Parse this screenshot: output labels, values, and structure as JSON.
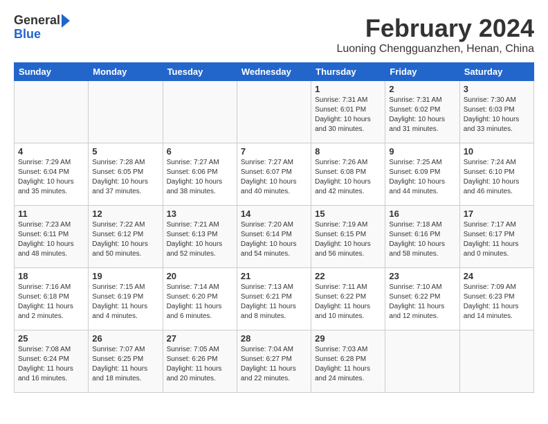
{
  "logo": {
    "line1": "General",
    "line2": "Blue"
  },
  "title": "February 2024",
  "location": "Luoning Chengguanzhen, Henan, China",
  "weekdays": [
    "Sunday",
    "Monday",
    "Tuesday",
    "Wednesday",
    "Thursday",
    "Friday",
    "Saturday"
  ],
  "weeks": [
    [
      {
        "day": "",
        "info": ""
      },
      {
        "day": "",
        "info": ""
      },
      {
        "day": "",
        "info": ""
      },
      {
        "day": "",
        "info": ""
      },
      {
        "day": "1",
        "info": "Sunrise: 7:31 AM\nSunset: 6:01 PM\nDaylight: 10 hours and 30 minutes."
      },
      {
        "day": "2",
        "info": "Sunrise: 7:31 AM\nSunset: 6:02 PM\nDaylight: 10 hours and 31 minutes."
      },
      {
        "day": "3",
        "info": "Sunrise: 7:30 AM\nSunset: 6:03 PM\nDaylight: 10 hours and 33 minutes."
      }
    ],
    [
      {
        "day": "4",
        "info": "Sunrise: 7:29 AM\nSunset: 6:04 PM\nDaylight: 10 hours and 35 minutes."
      },
      {
        "day": "5",
        "info": "Sunrise: 7:28 AM\nSunset: 6:05 PM\nDaylight: 10 hours and 37 minutes."
      },
      {
        "day": "6",
        "info": "Sunrise: 7:27 AM\nSunset: 6:06 PM\nDaylight: 10 hours and 38 minutes."
      },
      {
        "day": "7",
        "info": "Sunrise: 7:27 AM\nSunset: 6:07 PM\nDaylight: 10 hours and 40 minutes."
      },
      {
        "day": "8",
        "info": "Sunrise: 7:26 AM\nSunset: 6:08 PM\nDaylight: 10 hours and 42 minutes."
      },
      {
        "day": "9",
        "info": "Sunrise: 7:25 AM\nSunset: 6:09 PM\nDaylight: 10 hours and 44 minutes."
      },
      {
        "day": "10",
        "info": "Sunrise: 7:24 AM\nSunset: 6:10 PM\nDaylight: 10 hours and 46 minutes."
      }
    ],
    [
      {
        "day": "11",
        "info": "Sunrise: 7:23 AM\nSunset: 6:11 PM\nDaylight: 10 hours and 48 minutes."
      },
      {
        "day": "12",
        "info": "Sunrise: 7:22 AM\nSunset: 6:12 PM\nDaylight: 10 hours and 50 minutes."
      },
      {
        "day": "13",
        "info": "Sunrise: 7:21 AM\nSunset: 6:13 PM\nDaylight: 10 hours and 52 minutes."
      },
      {
        "day": "14",
        "info": "Sunrise: 7:20 AM\nSunset: 6:14 PM\nDaylight: 10 hours and 54 minutes."
      },
      {
        "day": "15",
        "info": "Sunrise: 7:19 AM\nSunset: 6:15 PM\nDaylight: 10 hours and 56 minutes."
      },
      {
        "day": "16",
        "info": "Sunrise: 7:18 AM\nSunset: 6:16 PM\nDaylight: 10 hours and 58 minutes."
      },
      {
        "day": "17",
        "info": "Sunrise: 7:17 AM\nSunset: 6:17 PM\nDaylight: 11 hours and 0 minutes."
      }
    ],
    [
      {
        "day": "18",
        "info": "Sunrise: 7:16 AM\nSunset: 6:18 PM\nDaylight: 11 hours and 2 minutes."
      },
      {
        "day": "19",
        "info": "Sunrise: 7:15 AM\nSunset: 6:19 PM\nDaylight: 11 hours and 4 minutes."
      },
      {
        "day": "20",
        "info": "Sunrise: 7:14 AM\nSunset: 6:20 PM\nDaylight: 11 hours and 6 minutes."
      },
      {
        "day": "21",
        "info": "Sunrise: 7:13 AM\nSunset: 6:21 PM\nDaylight: 11 hours and 8 minutes."
      },
      {
        "day": "22",
        "info": "Sunrise: 7:11 AM\nSunset: 6:22 PM\nDaylight: 11 hours and 10 minutes."
      },
      {
        "day": "23",
        "info": "Sunrise: 7:10 AM\nSunset: 6:22 PM\nDaylight: 11 hours and 12 minutes."
      },
      {
        "day": "24",
        "info": "Sunrise: 7:09 AM\nSunset: 6:23 PM\nDaylight: 11 hours and 14 minutes."
      }
    ],
    [
      {
        "day": "25",
        "info": "Sunrise: 7:08 AM\nSunset: 6:24 PM\nDaylight: 11 hours and 16 minutes."
      },
      {
        "day": "26",
        "info": "Sunrise: 7:07 AM\nSunset: 6:25 PM\nDaylight: 11 hours and 18 minutes."
      },
      {
        "day": "27",
        "info": "Sunrise: 7:05 AM\nSunset: 6:26 PM\nDaylight: 11 hours and 20 minutes."
      },
      {
        "day": "28",
        "info": "Sunrise: 7:04 AM\nSunset: 6:27 PM\nDaylight: 11 hours and 22 minutes."
      },
      {
        "day": "29",
        "info": "Sunrise: 7:03 AM\nSunset: 6:28 PM\nDaylight: 11 hours and 24 minutes."
      },
      {
        "day": "",
        "info": ""
      },
      {
        "day": "",
        "info": ""
      }
    ]
  ]
}
